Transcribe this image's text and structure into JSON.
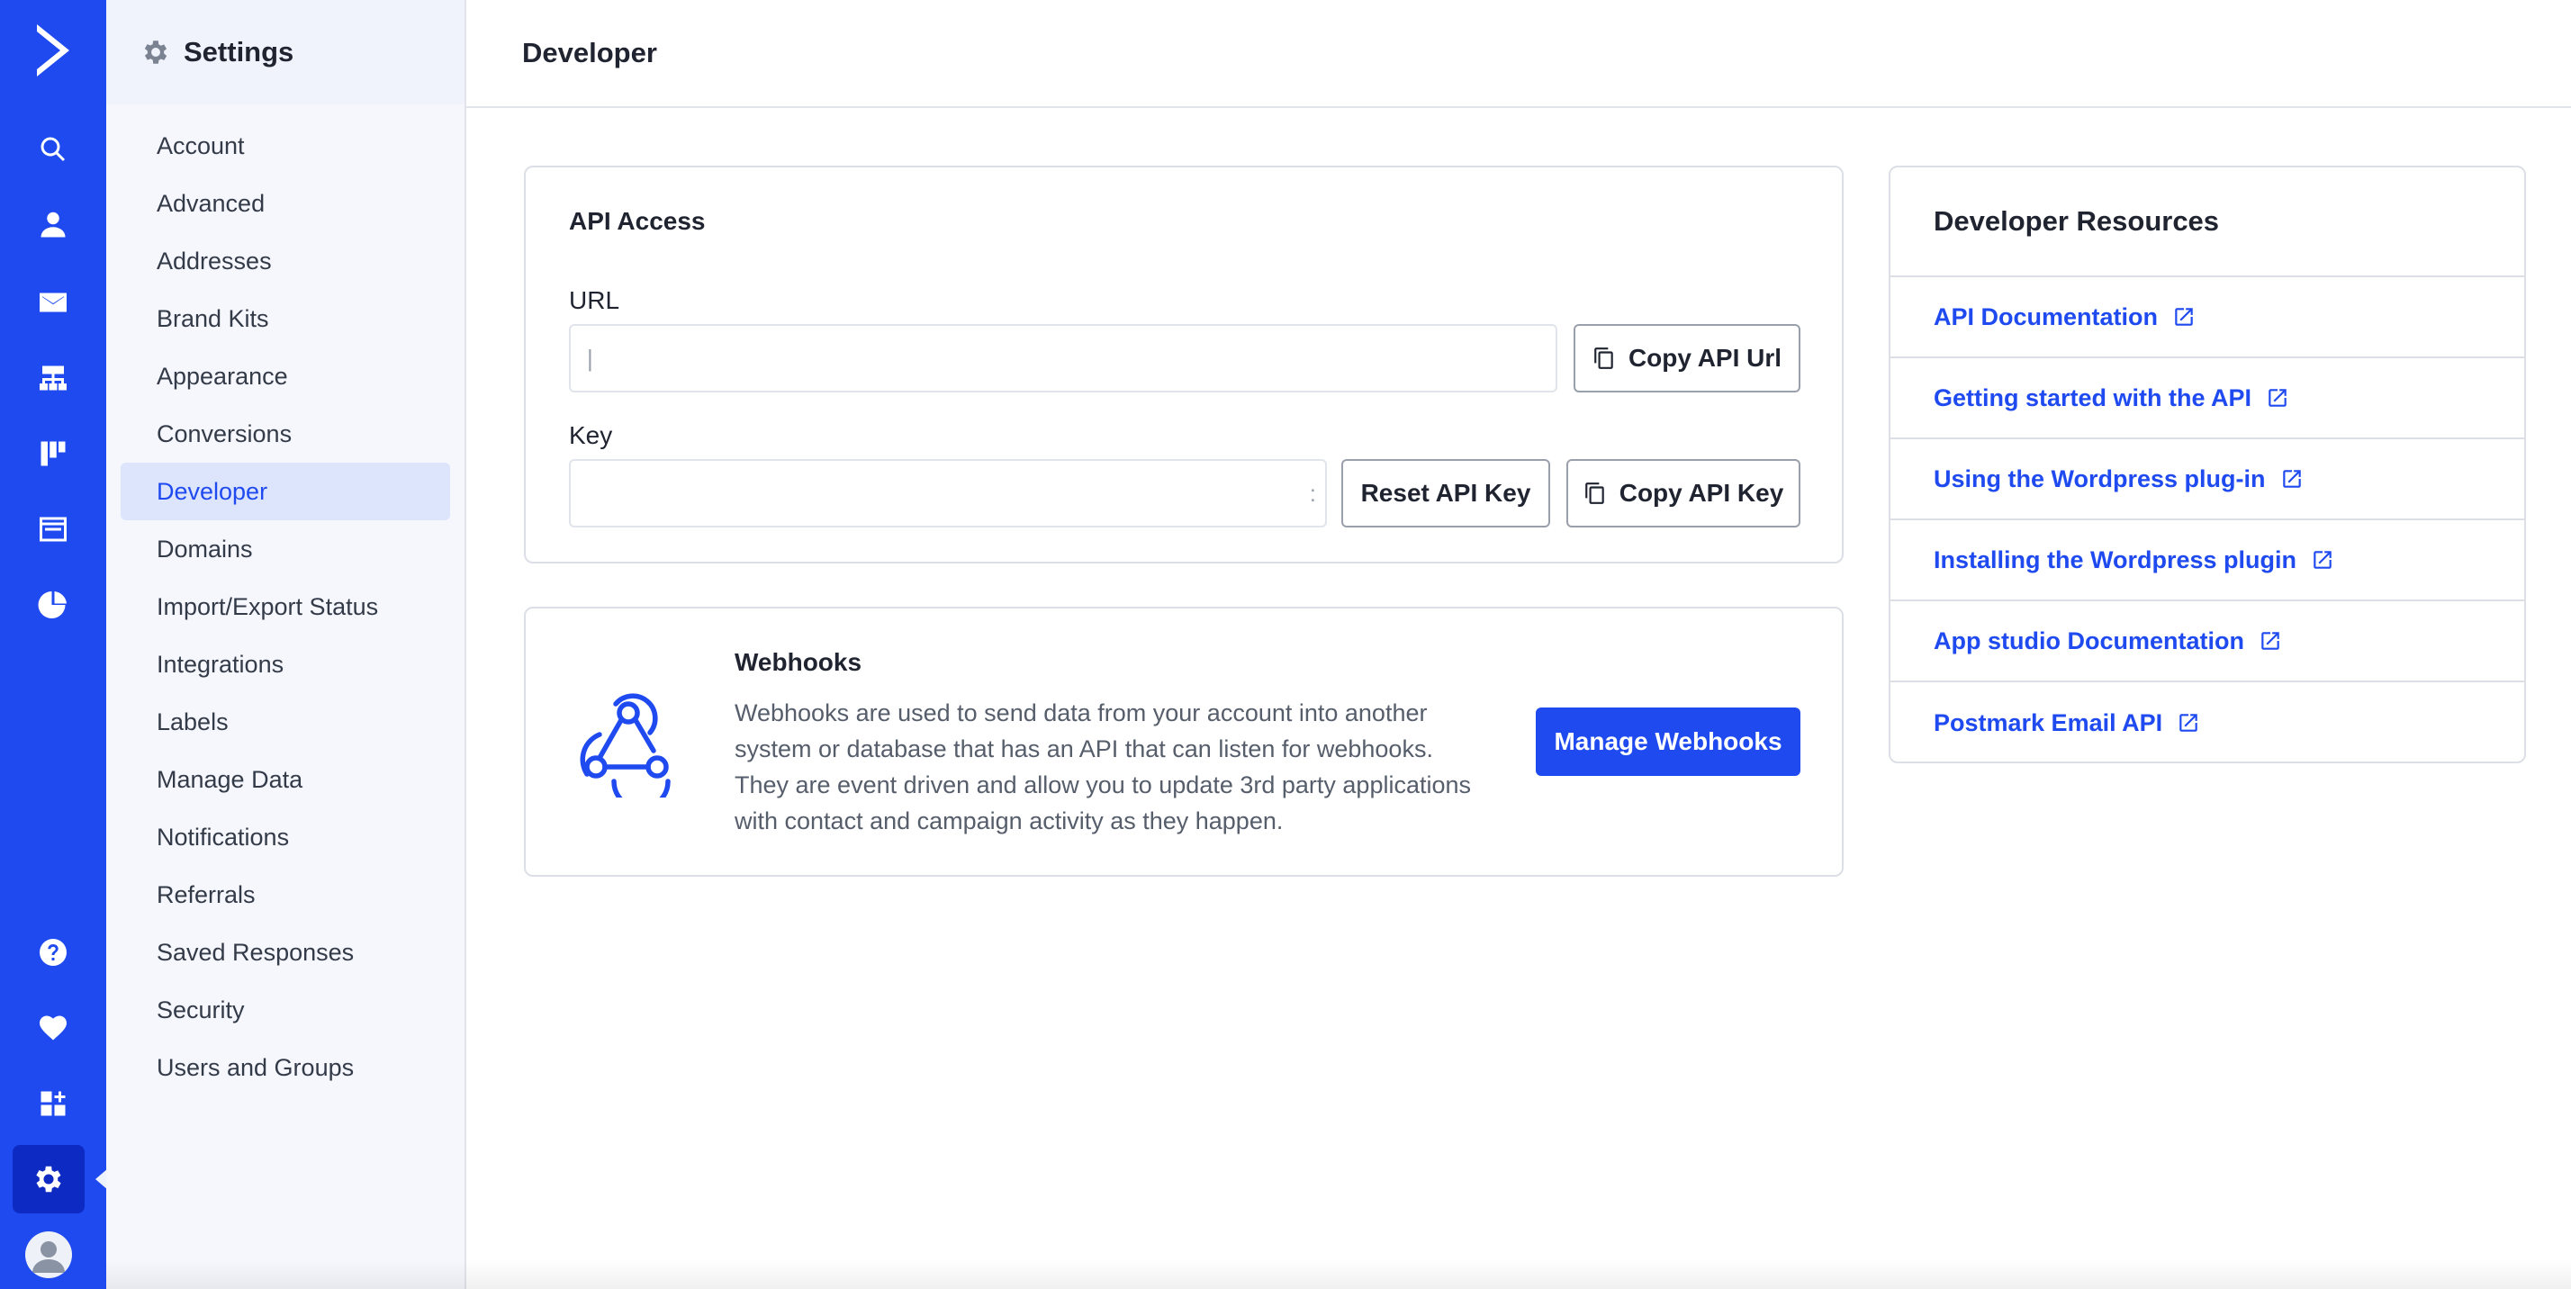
{
  "settings": {
    "title": "Settings"
  },
  "nav": [
    {
      "label": "Account"
    },
    {
      "label": "Advanced"
    },
    {
      "label": "Addresses"
    },
    {
      "label": "Brand Kits"
    },
    {
      "label": "Appearance"
    },
    {
      "label": "Conversions"
    },
    {
      "label": "Developer",
      "active": true
    },
    {
      "label": "Domains"
    },
    {
      "label": "Import/Export Status"
    },
    {
      "label": "Integrations"
    },
    {
      "label": "Labels"
    },
    {
      "label": "Manage Data"
    },
    {
      "label": "Notifications"
    },
    {
      "label": "Referrals"
    },
    {
      "label": "Saved Responses"
    },
    {
      "label": "Security"
    },
    {
      "label": "Users and Groups"
    }
  ],
  "rail": {
    "icons": [
      "logo-icon",
      "search-icon",
      "contacts-icon",
      "campaigns-icon",
      "automations-icon",
      "pipelines-icon",
      "website-icon",
      "reports-icon",
      "help-icon",
      "heart-icon",
      "apps-icon",
      "settings-icon",
      "avatar-icon"
    ],
    "accent_color": "#1e4af0",
    "active_color": "#0d2ac2"
  },
  "header": {
    "title": "Developer"
  },
  "api": {
    "heading": "API Access",
    "url_label": "URL",
    "url_value": "|",
    "copy_url_label": "Copy API Url",
    "key_label": "Key",
    "key_value": ":",
    "reset_key_label": "Reset API Key",
    "copy_key_label": "Copy API Key"
  },
  "webhooks": {
    "title": "Webhooks",
    "description": "Webhooks are used to send data from your account into another system or database that has an API that can listen for webhooks. They are event driven and allow you to update 3rd party applications with contact and campaign activity as they happen.",
    "button_label": "Manage Webhooks",
    "icon": "webhook-icon"
  },
  "resources": {
    "title": "Developer Resources",
    "links": [
      {
        "label": "API Documentation"
      },
      {
        "label": "Getting started with the API"
      },
      {
        "label": "Using the Wordpress plug-in"
      },
      {
        "label": "Installing the Wordpress plugin"
      },
      {
        "label": "App studio Documentation"
      },
      {
        "label": "Postmark Email API"
      }
    ]
  }
}
